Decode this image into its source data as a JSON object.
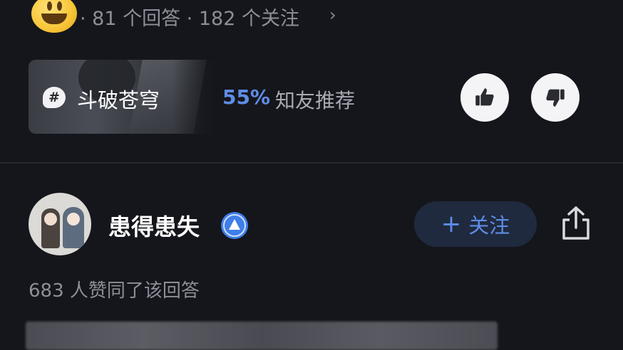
{
  "question_stats": {
    "text": "· 81 个回答 · 182 个关注",
    "chevron": "›"
  },
  "topic_card": {
    "icon": "hash-icon",
    "name": "斗破苍穹"
  },
  "recommendation": {
    "percent": "55%",
    "label": "知友推荐"
  },
  "reactions": {
    "like_icon": "thumbs-up-icon",
    "dislike_icon": "thumbs-down-icon"
  },
  "author": {
    "name": "患得患失",
    "badge_icon": "verified-badge-icon",
    "follow_label": "关注",
    "follow_plus": "+"
  },
  "answer": {
    "agree_text": "683 人赞同了该回答"
  },
  "colors": {
    "background": "#15161c",
    "accent_blue": "#5e8de6",
    "muted_text": "#8d8e98"
  }
}
